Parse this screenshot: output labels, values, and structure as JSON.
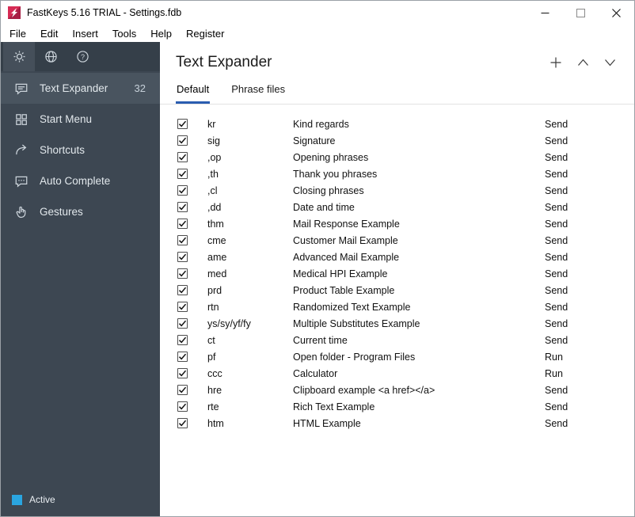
{
  "window": {
    "title": "FastKeys 5.16 TRIAL - Settings.fdb"
  },
  "menu": {
    "items": [
      "File",
      "Edit",
      "Insert",
      "Tools",
      "Help",
      "Register"
    ]
  },
  "sidebar": {
    "items": [
      {
        "label": "Text Expander",
        "badge": "32"
      },
      {
        "label": "Start Menu"
      },
      {
        "label": "Shortcuts"
      },
      {
        "label": "Auto Complete"
      },
      {
        "label": "Gestures"
      }
    ],
    "status_label": "Active",
    "status_color": "#2aa5e0"
  },
  "main": {
    "title": "Text Expander",
    "tabs": [
      {
        "label": "Default"
      },
      {
        "label": "Phrase files"
      }
    ],
    "accent_color": "#2a5db0",
    "table": {
      "rows": [
        {
          "checked": true,
          "abbr": "kr",
          "description": "Kind regards",
          "action": "Send"
        },
        {
          "checked": true,
          "abbr": "sig",
          "description": "Signature",
          "action": "Send"
        },
        {
          "checked": true,
          "abbr": ",op",
          "description": "Opening phrases",
          "action": "Send"
        },
        {
          "checked": true,
          "abbr": ",th",
          "description": "Thank you phrases",
          "action": "Send"
        },
        {
          "checked": true,
          "abbr": ",cl",
          "description": "Closing phrases",
          "action": "Send"
        },
        {
          "checked": true,
          "abbr": ",dd",
          "description": "Date and time",
          "action": "Send"
        },
        {
          "checked": true,
          "abbr": "thm",
          "description": "Mail Response Example",
          "action": "Send"
        },
        {
          "checked": true,
          "abbr": "cme",
          "description": "Customer Mail Example",
          "action": "Send"
        },
        {
          "checked": true,
          "abbr": "ame",
          "description": "Advanced Mail Example",
          "action": "Send"
        },
        {
          "checked": true,
          "abbr": "med",
          "description": "Medical HPI Example",
          "action": "Send"
        },
        {
          "checked": true,
          "abbr": "prd",
          "description": "Product Table Example",
          "action": "Send"
        },
        {
          "checked": true,
          "abbr": "rtn",
          "description": "Randomized Text Example",
          "action": "Send"
        },
        {
          "checked": true,
          "abbr": "ys/sy/yf/fy",
          "description": "Multiple Substitutes Example",
          "action": "Send"
        },
        {
          "checked": true,
          "abbr": "ct",
          "description": "Current time",
          "action": "Send"
        },
        {
          "checked": true,
          "abbr": "pf",
          "description": "Open folder - Program Files",
          "action": "Run"
        },
        {
          "checked": true,
          "abbr": "ccc",
          "description": "Calculator",
          "action": "Run"
        },
        {
          "checked": true,
          "abbr": "hre",
          "description": "Clipboard example <a href></a>",
          "action": "Send"
        },
        {
          "checked": true,
          "abbr": "rte",
          "description": "Rich Text Example",
          "action": "Send"
        },
        {
          "checked": true,
          "abbr": "htm",
          "description": "HTML Example",
          "action": "Send"
        }
      ]
    }
  }
}
